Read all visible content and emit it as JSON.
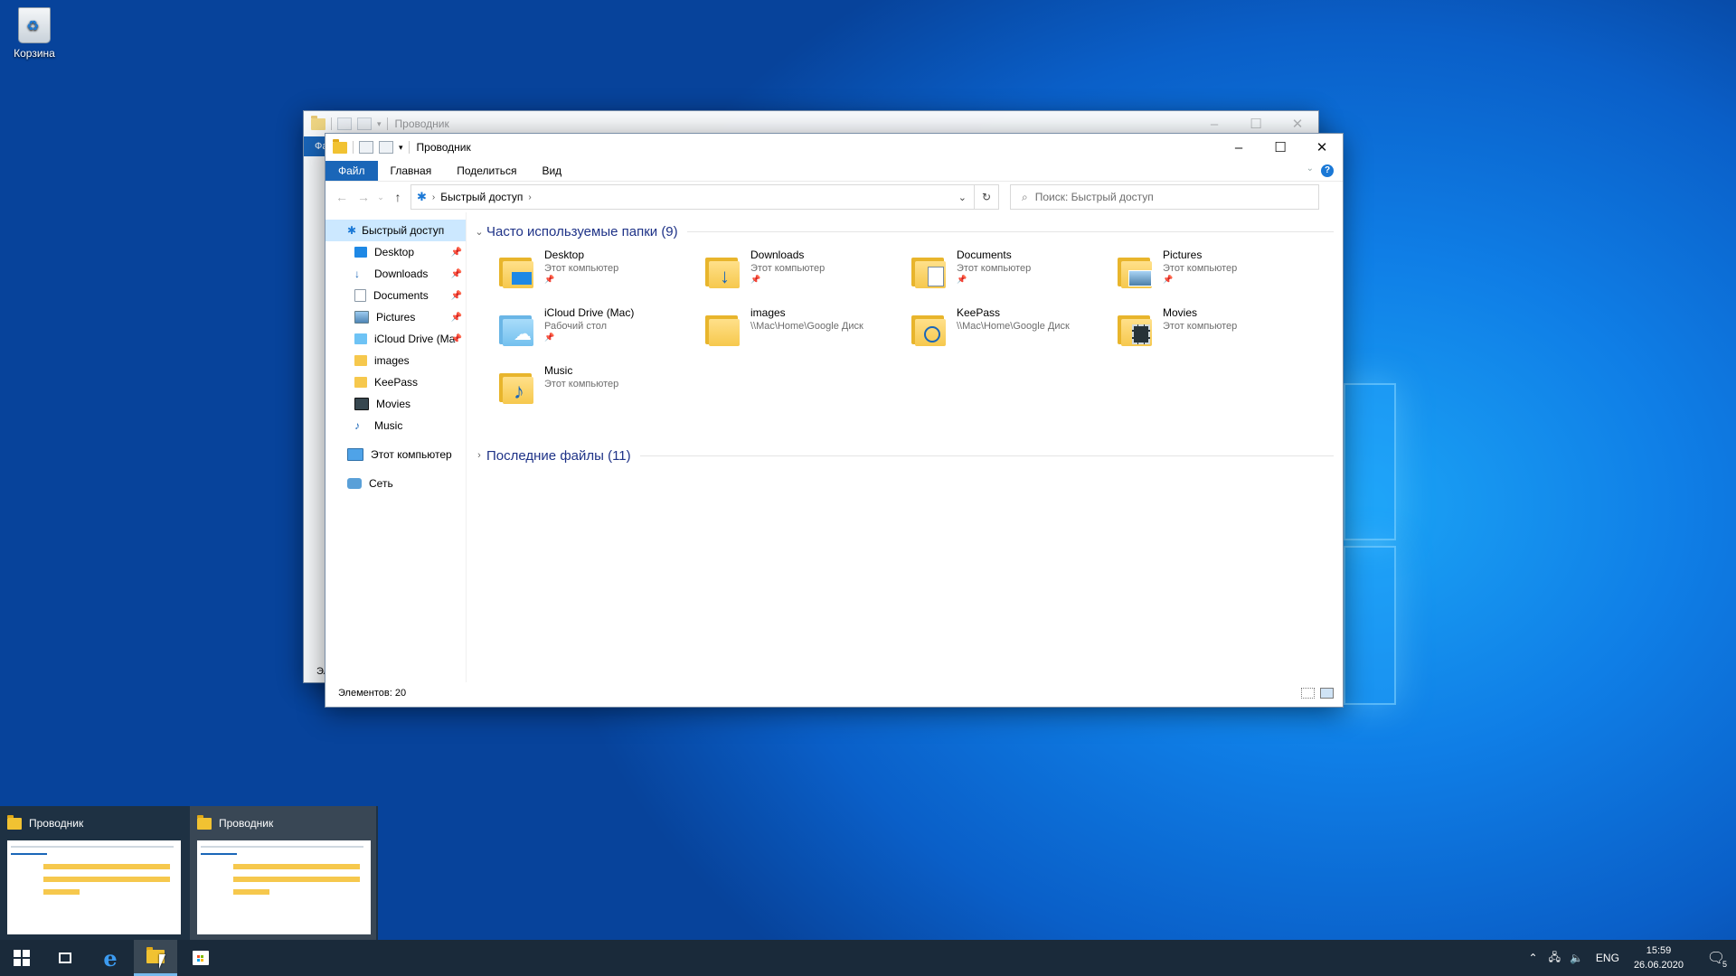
{
  "desktop": {
    "recycle_bin_label": "Корзина"
  },
  "back_window": {
    "title": "Проводник",
    "file_tab_partial": "Фа",
    "status_partial": "Эл"
  },
  "window": {
    "title": "Проводник",
    "ribbon_tabs": [
      "Файл",
      "Главная",
      "Поделиться",
      "Вид"
    ],
    "address": {
      "crumb": "Быстрый доступ"
    },
    "search_placeholder": "Поиск: Быстрый доступ",
    "nav_items": [
      {
        "label": "Быстрый доступ",
        "icon": "star-icon",
        "pinned": false
      },
      {
        "label": "Desktop",
        "icon": "desktop-icon",
        "pinned": true
      },
      {
        "label": "Downloads",
        "icon": "download-icon",
        "pinned": true
      },
      {
        "label": "Documents",
        "icon": "document-icon",
        "pinned": true
      },
      {
        "label": "Pictures",
        "icon": "picture-icon",
        "pinned": true
      },
      {
        "label": "iCloud Drive (Ma",
        "icon": "cloud-icon",
        "pinned": true
      },
      {
        "label": "images",
        "icon": "folder-icon",
        "pinned": false
      },
      {
        "label": "KeePass",
        "icon": "folder-icon",
        "pinned": false
      },
      {
        "label": "Movies",
        "icon": "film-icon",
        "pinned": false
      },
      {
        "label": "Music",
        "icon": "music-note-icon",
        "pinned": false
      },
      {
        "label": "Этот компьютер",
        "icon": "computer-icon",
        "pinned": false
      },
      {
        "label": "Сеть",
        "icon": "network-icon",
        "pinned": false
      }
    ],
    "frequent_header": "Часто используемые папки (9)",
    "recent_header": "Последние файлы (11)",
    "folders": [
      {
        "name": "Desktop",
        "location": "Этот компьютер",
        "pinned": true,
        "icon": "desktop-icon"
      },
      {
        "name": "Downloads",
        "location": "Этот компьютер",
        "pinned": true,
        "icon": "download-icon"
      },
      {
        "name": "Documents",
        "location": "Этот компьютер",
        "pinned": true,
        "icon": "document-icon"
      },
      {
        "name": "Pictures",
        "location": "Этот компьютер",
        "pinned": true,
        "icon": "picture-icon"
      },
      {
        "name": "iCloud Drive (Mac)",
        "location": "Рабочий стол",
        "pinned": true,
        "icon": "cloud-icon"
      },
      {
        "name": "images",
        "location": "\\\\Mac\\Home\\Google Диск",
        "pinned": false,
        "icon": "folder-icon"
      },
      {
        "name": "KeePass",
        "location": "\\\\Mac\\Home\\Google Диск",
        "pinned": false,
        "icon": "keepass-icon"
      },
      {
        "name": "Movies",
        "location": "Этот компьютер",
        "pinned": false,
        "icon": "film-icon"
      },
      {
        "name": "Music",
        "location": "Этот компьютер",
        "pinned": false,
        "icon": "music-note-icon"
      }
    ],
    "status": "Элементов: 20"
  },
  "thumbnails": [
    {
      "title": "Проводник"
    },
    {
      "title": "Проводник"
    }
  ],
  "taskbar": {
    "lang": "ENG",
    "time": "15:59",
    "date": "26.06.2020",
    "notifications": "5"
  },
  "colors": {
    "accent": "#1a66b8",
    "selected": "#cce8ff",
    "folder": "#f6c84d"
  }
}
